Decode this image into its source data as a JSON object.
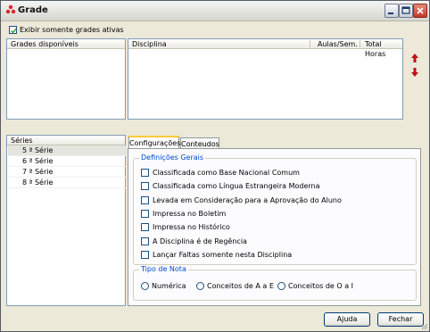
{
  "window": {
    "title": "Grade"
  },
  "filter": {
    "show_active_label": "Exibir somente grades ativas",
    "show_active_checked": true
  },
  "grades_panel": {
    "header": "Grades disponíveis"
  },
  "disciplinas_panel": {
    "columns": [
      "Disciplina",
      "Aulas/Sem.",
      "Total Horas"
    ]
  },
  "series_panel": {
    "header": "Séries",
    "items": [
      {
        "label": "5 ª Série",
        "selected": true
      },
      {
        "label": "6 ª Série",
        "selected": false
      },
      {
        "label": "7 ª Série",
        "selected": false
      },
      {
        "label": "8 ª Série",
        "selected": false
      }
    ]
  },
  "tabs": [
    {
      "label": "Configurações",
      "active": true
    },
    {
      "label": "Conteudos",
      "active": false
    }
  ],
  "definicoes": {
    "title": "Definições Gerais",
    "options": [
      "Classificada como Base Nacional Comum",
      "Classificada como Língua Estrangeira Moderna",
      "Levada em Consideração para a Aprovação do Aluno",
      "Impressa no Boletim",
      "Impressa no Histórico",
      "A Disciplina é de Regência",
      "Lançar Faltas somente nesta Disciplina"
    ]
  },
  "tipo_nota": {
    "title": "Tipo de Nota",
    "options": [
      "Numérica",
      "Conceitos de A a E",
      "Conceitos de O a I"
    ]
  },
  "footer": {
    "help_label": "Ajuda",
    "close_label": "Fechar"
  },
  "colors": {
    "accent": "#0046d5",
    "arrow": "#c0101a"
  }
}
